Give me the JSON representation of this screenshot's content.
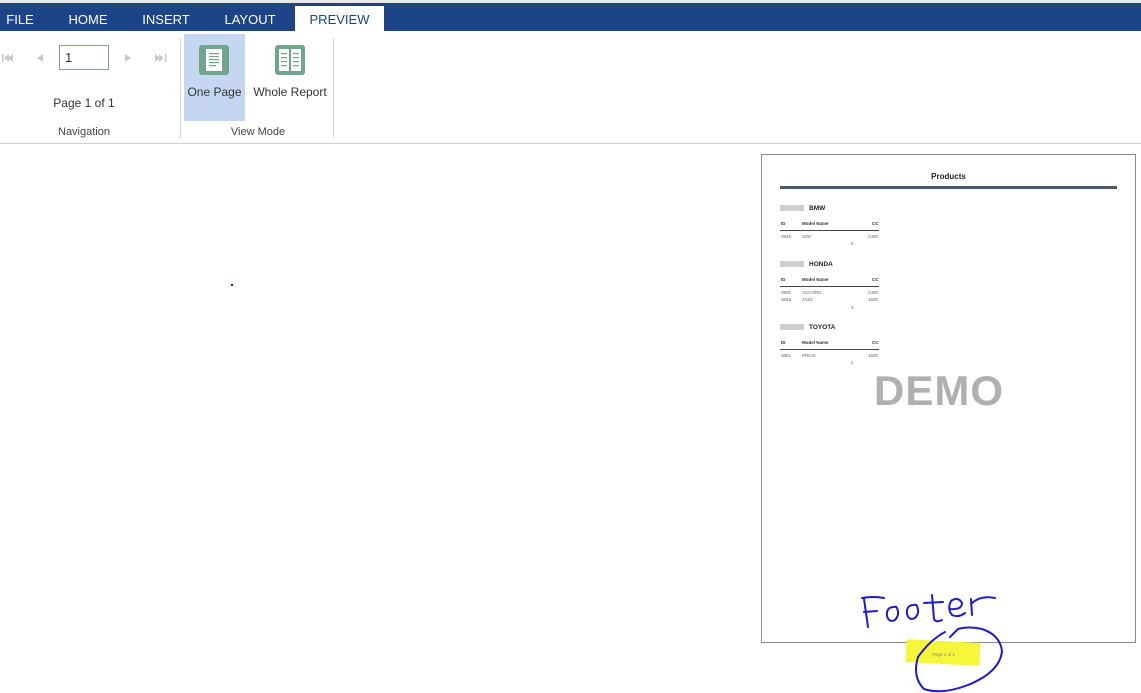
{
  "menu": {
    "tabs": [
      {
        "label": "FILE"
      },
      {
        "label": "HOME"
      },
      {
        "label": "INSERT"
      },
      {
        "label": "LAYOUT"
      },
      {
        "label": "PREVIEW",
        "active": true
      }
    ]
  },
  "ribbon": {
    "navigation": {
      "page_value": "1",
      "page_status": "Page 1 of 1",
      "group_label": "Navigation"
    },
    "view_mode": {
      "one_page_label": "One Page",
      "whole_report_label": "Whole Report",
      "group_label": "View Mode",
      "selected": "One Page"
    }
  },
  "preview": {
    "title": "Products",
    "columns": [
      "ID",
      "Model Name",
      "CC"
    ],
    "groups": [
      {
        "name": "BMW",
        "rows": [
          [
            "3845",
            "325I",
            "2400"
          ]
        ],
        "count": "2"
      },
      {
        "name": "HONDA",
        "rows": [
          [
            "3850",
            "ACCORD",
            "2400"
          ],
          [
            "3849",
            "JAZZ",
            "1500"
          ]
        ],
        "count": "3"
      },
      {
        "name": "TOYOTA",
        "rows": [
          [
            "3851",
            "PRIUS",
            "1500"
          ]
        ],
        "count": "2"
      }
    ],
    "watermark": "DEMO",
    "footer": "Page 1 of 1"
  },
  "colors": {
    "menubar": "#1b4586",
    "selected_button": "#c5d7f0",
    "icon": "#6fa68c",
    "annotation_ink": "#1b1bd0",
    "highlight": "#f5f53a"
  },
  "icons": [
    "first-page-icon",
    "previous-page-icon",
    "next-page-icon",
    "last-page-icon",
    "one-page-icon",
    "whole-report-icon"
  ]
}
